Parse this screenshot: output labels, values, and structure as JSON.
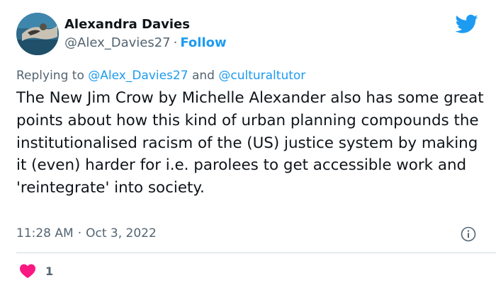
{
  "author": {
    "name": "Alexandra Davies",
    "handle": "@Alex_Davies27",
    "follow_label": "Follow"
  },
  "reply": {
    "prefix": "Replying to",
    "mention1": "@Alex_Davies27",
    "joiner": "and",
    "mention2": "@culturaltutor"
  },
  "tweet": {
    "text": "The New Jim Crow by Michelle Alexander also has some great points about how this kind of urban planning compounds the institutionalised racism of the (US) justice system by making it (even) harder for i.e. parolees to get accessible work and 'reintegrate' into society.",
    "time": "11:28 AM",
    "date": "Oct 3, 2022"
  },
  "engagement": {
    "likes": "1"
  },
  "colors": {
    "accent": "#1d9bf0",
    "like": "#f91880",
    "muted": "#536471"
  },
  "icons": {
    "brand": "twitter-bird-icon",
    "info": "info-icon",
    "like": "heart-icon"
  }
}
